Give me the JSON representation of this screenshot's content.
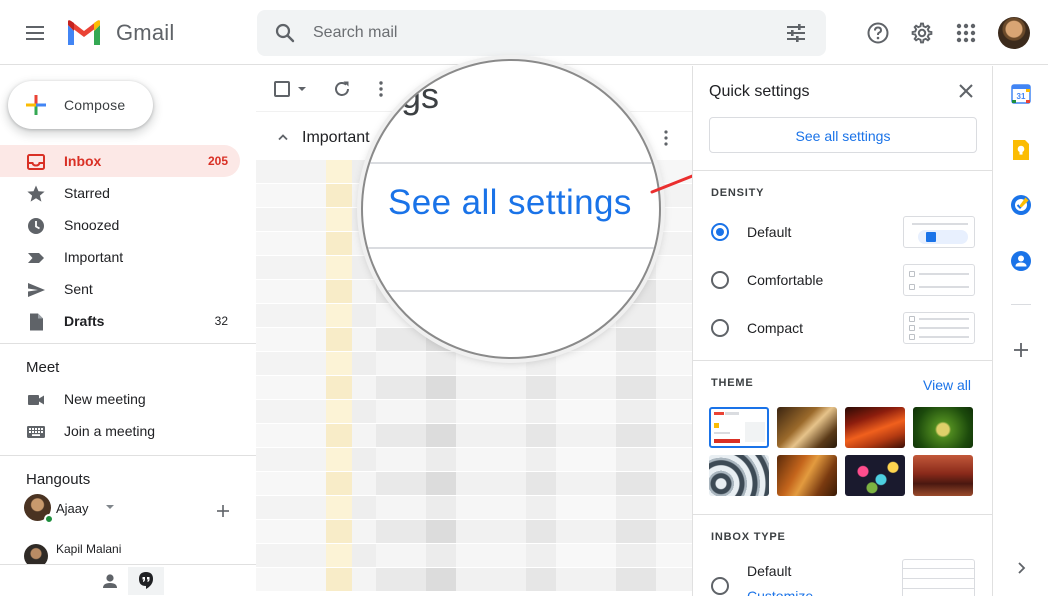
{
  "header": {
    "app_name": "Gmail",
    "search_placeholder": "Search mail"
  },
  "sidebar": {
    "compose_label": "Compose",
    "items": [
      {
        "label": "Inbox",
        "count": "205",
        "icon": "inbox-icon"
      },
      {
        "label": "Starred",
        "count": "",
        "icon": "star-icon"
      },
      {
        "label": "Snoozed",
        "count": "",
        "icon": "clock-icon"
      },
      {
        "label": "Important",
        "count": "",
        "icon": "important-icon"
      },
      {
        "label": "Sent",
        "count": "",
        "icon": "send-icon"
      },
      {
        "label": "Drafts",
        "count": "32",
        "icon": "draft-icon"
      }
    ],
    "meet": {
      "title": "Meet",
      "new_meeting": "New meeting",
      "join_meeting": "Join a meeting"
    },
    "hangouts": {
      "title": "Hangouts",
      "user_name": "Ajaay",
      "contact_name": "Kapil Malani"
    }
  },
  "main": {
    "section_title": "Important"
  },
  "magnifier": {
    "top_text": "gs",
    "link_text": "See all settings"
  },
  "quick_settings": {
    "title": "Quick settings",
    "see_all": "See all settings",
    "density_heading": "DENSITY",
    "density_options": [
      "Default",
      "Comfortable",
      "Compact"
    ],
    "density_selected": "Default",
    "theme_heading": "THEME",
    "view_all": "View all",
    "inbox_type_heading": "INBOX TYPE",
    "inbox_type_option": "Default",
    "customize": "Customize"
  },
  "colors": {
    "accent": "#1a73e8",
    "inbox_active": "#d93025",
    "inbox_active_bg": "#fce8e6",
    "arrow": "#ea2e2e"
  }
}
